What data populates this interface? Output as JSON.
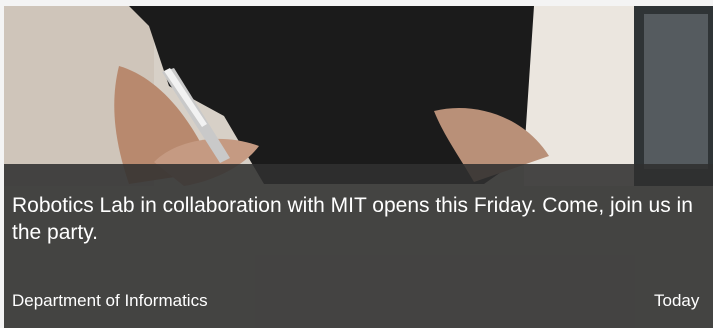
{
  "news_card": {
    "headline": "Robotics Lab in collaboration with MIT opens this Friday. Come, join us in the party.",
    "department": "Department of Informatics",
    "date": "Today",
    "overlay_color": "#303030",
    "image_subject": "person-writing-with-pen-photo"
  }
}
